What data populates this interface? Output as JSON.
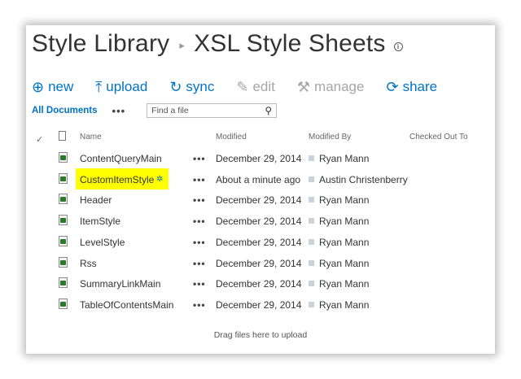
{
  "breadcrumb": {
    "parent": "Style Library",
    "current": "XSL Style Sheets"
  },
  "toolbar": {
    "new": "new",
    "upload": "upload",
    "sync": "sync",
    "edit": "edit",
    "manage": "manage",
    "share": "share"
  },
  "view": {
    "name": "All Documents",
    "more": "•••",
    "search_placeholder": "Find a file"
  },
  "columns": {
    "name": "Name",
    "modified": "Modified",
    "modified_by": "Modified By",
    "checked_out": "Checked Out To"
  },
  "files": [
    {
      "name": "ContentQueryMain",
      "modified": "December 29, 2014",
      "modified_by": "Ryan Mann"
    },
    {
      "name": "CustomItemStyle",
      "modified": "About a minute ago",
      "modified_by": "Austin Christenberry",
      "new": true
    },
    {
      "name": "Header",
      "modified": "December 29, 2014",
      "modified_by": "Ryan Mann"
    },
    {
      "name": "ItemStyle",
      "modified": "December 29, 2014",
      "modified_by": "Ryan Mann"
    },
    {
      "name": "LevelStyle",
      "modified": "December 29, 2014",
      "modified_by": "Ryan Mann"
    },
    {
      "name": "Rss",
      "modified": "December 29, 2014",
      "modified_by": "Ryan Mann"
    },
    {
      "name": "SummaryLinkMain",
      "modified": "December 29, 2014",
      "modified_by": "Ryan Mann"
    },
    {
      "name": "TableOfContentsMain",
      "modified": "December 29, 2014",
      "modified_by": "Ryan Mann"
    }
  ],
  "row_ellipsis": "•••",
  "footer": "Drag files here to upload",
  "colors": {
    "accent": "#0072c6",
    "disabled": "#a6a6a6",
    "highlight": "#ffff00"
  }
}
